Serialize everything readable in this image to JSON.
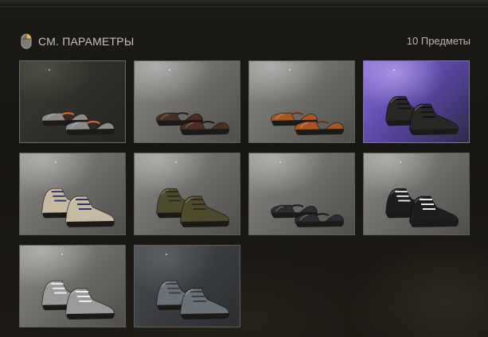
{
  "header": {
    "title": "СМ. ПАРАМЕТРЫ",
    "count": "10 Предметы",
    "icon": "mouse-icon"
  },
  "items": [
    {
      "icon": "sneakers-orange-laces-icon",
      "background": "dark",
      "shoe_color": "#8a8a8a",
      "accent": "#e0692e"
    },
    {
      "icon": "brown-dress-shoes-icon",
      "background": "grey",
      "shoe_color": "#4a2e22",
      "accent": "#2a1a12"
    },
    {
      "icon": "tan-dress-shoes-icon",
      "background": "grey",
      "shoe_color": "#a8561f",
      "accent": "#6a3212"
    },
    {
      "icon": "black-combat-boots-icon",
      "background": "purple",
      "shoe_color": "#2a2826",
      "accent": "#111111"
    },
    {
      "icon": "hiking-boots-icon",
      "background": "grey",
      "shoe_color": "#c8b9a2",
      "accent": "#2d3566"
    },
    {
      "icon": "olive-military-boots-icon",
      "background": "grey",
      "shoe_color": "#4e4a2e",
      "accent": "#2c2a1a"
    },
    {
      "icon": "black-slip-on-shoes-icon",
      "background": "grey",
      "shoe_color": "#2e2c30",
      "accent": "#18171a"
    },
    {
      "icon": "black-white-high-tops-icon",
      "background": "grey",
      "shoe_color": "#1e1e1e",
      "accent": "#e8e8e8"
    },
    {
      "icon": "snakeskin-high-tops-icon",
      "background": "grey",
      "shoe_color": "#9a9a98",
      "accent": "#eeeeee"
    },
    {
      "icon": "worn-grey-boots-icon",
      "background": "slate",
      "shoe_color": "#6a7078",
      "accent": "#3a3e44"
    }
  ]
}
